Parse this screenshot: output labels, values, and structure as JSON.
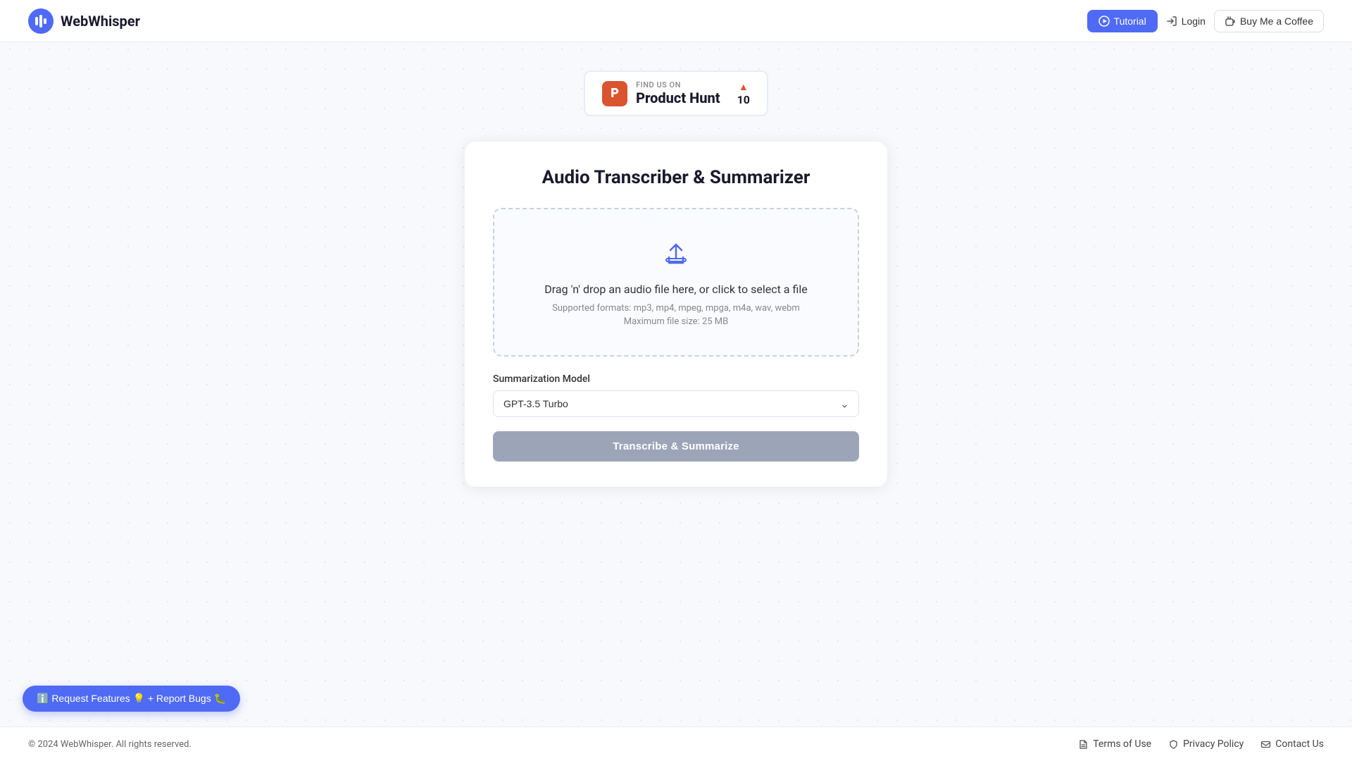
{
  "nav": {
    "logo_text": "WebWhisper",
    "tutorial_label": "Tutorial",
    "login_label": "Login",
    "coffee_label": "Buy Me a Coffee"
  },
  "product_hunt": {
    "find_text": "FIND US ON",
    "name": "Product Hunt",
    "count": "10",
    "arrow": "▲"
  },
  "card": {
    "title": "Audio Transcriber & Summarizer",
    "dropzone_main": "Drag 'n' drop an audio file here, or click to select a file",
    "dropzone_formats": "Supported formats: mp3, mp4, mpeg, mpga, m4a, wav, webm",
    "dropzone_size": "Maximum file size: 25 MB",
    "model_label": "Summarization Model",
    "model_default": "GPT-3.5 Turbo",
    "submit_label": "Transcribe & Summarize"
  },
  "feedback": {
    "label": "ℹ️ Request Features 💡 + Report Bugs 🐛"
  },
  "footer": {
    "copyright": "© 2024 WebWhisper. All rights reserved.",
    "terms_label": "Terms of Use",
    "privacy_label": "Privacy Policy",
    "contact_label": "Contact Us"
  },
  "icons": {
    "upload": "upload-icon",
    "play": "play-icon",
    "login": "login-icon",
    "coffee": "coffee-icon",
    "doc": "document-icon",
    "mail": "mail-icon",
    "shield": "shield-icon"
  }
}
